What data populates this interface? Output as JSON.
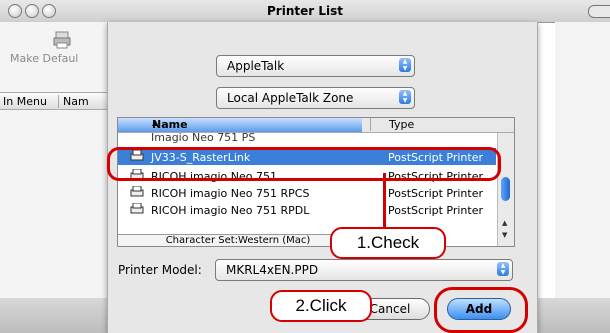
{
  "window": {
    "title": "Printer List"
  },
  "toolbar": {
    "make_default_label": "Make Defaul"
  },
  "left_header": {
    "col1": "In Menu",
    "col2": "Nam"
  },
  "connection": {
    "selected": "AppleTalk"
  },
  "zone": {
    "selected": "Local AppleTalk Zone"
  },
  "printer_list": {
    "headers": {
      "name": "Name",
      "type": "Type"
    },
    "rows": [
      {
        "name": "JV33-S_RasterLink",
        "type": "PostScript Printer",
        "selected": true
      },
      {
        "name": "RICOH imagio Neo 751",
        "type": "PostScript Printer",
        "selected": false
      },
      {
        "name": "RICOH imagio Neo 751 RPCS",
        "type": "PostScript Printer",
        "selected": false
      },
      {
        "name": "RICOH imagio Neo 751 RPDL",
        "type": "PostScript Printer",
        "selected": false
      }
    ],
    "charset": "Character Set:Western (Mac)"
  },
  "printer_model": {
    "label": "Printer Model:",
    "selected": "MKRL4xEN.PPD"
  },
  "buttons": {
    "cancel": "Cancel",
    "add": "Add"
  },
  "callouts": {
    "check": "1.Check",
    "click": "2.Click"
  },
  "colors": {
    "selection": "#3b7fd9",
    "highlight": "#d40000"
  }
}
